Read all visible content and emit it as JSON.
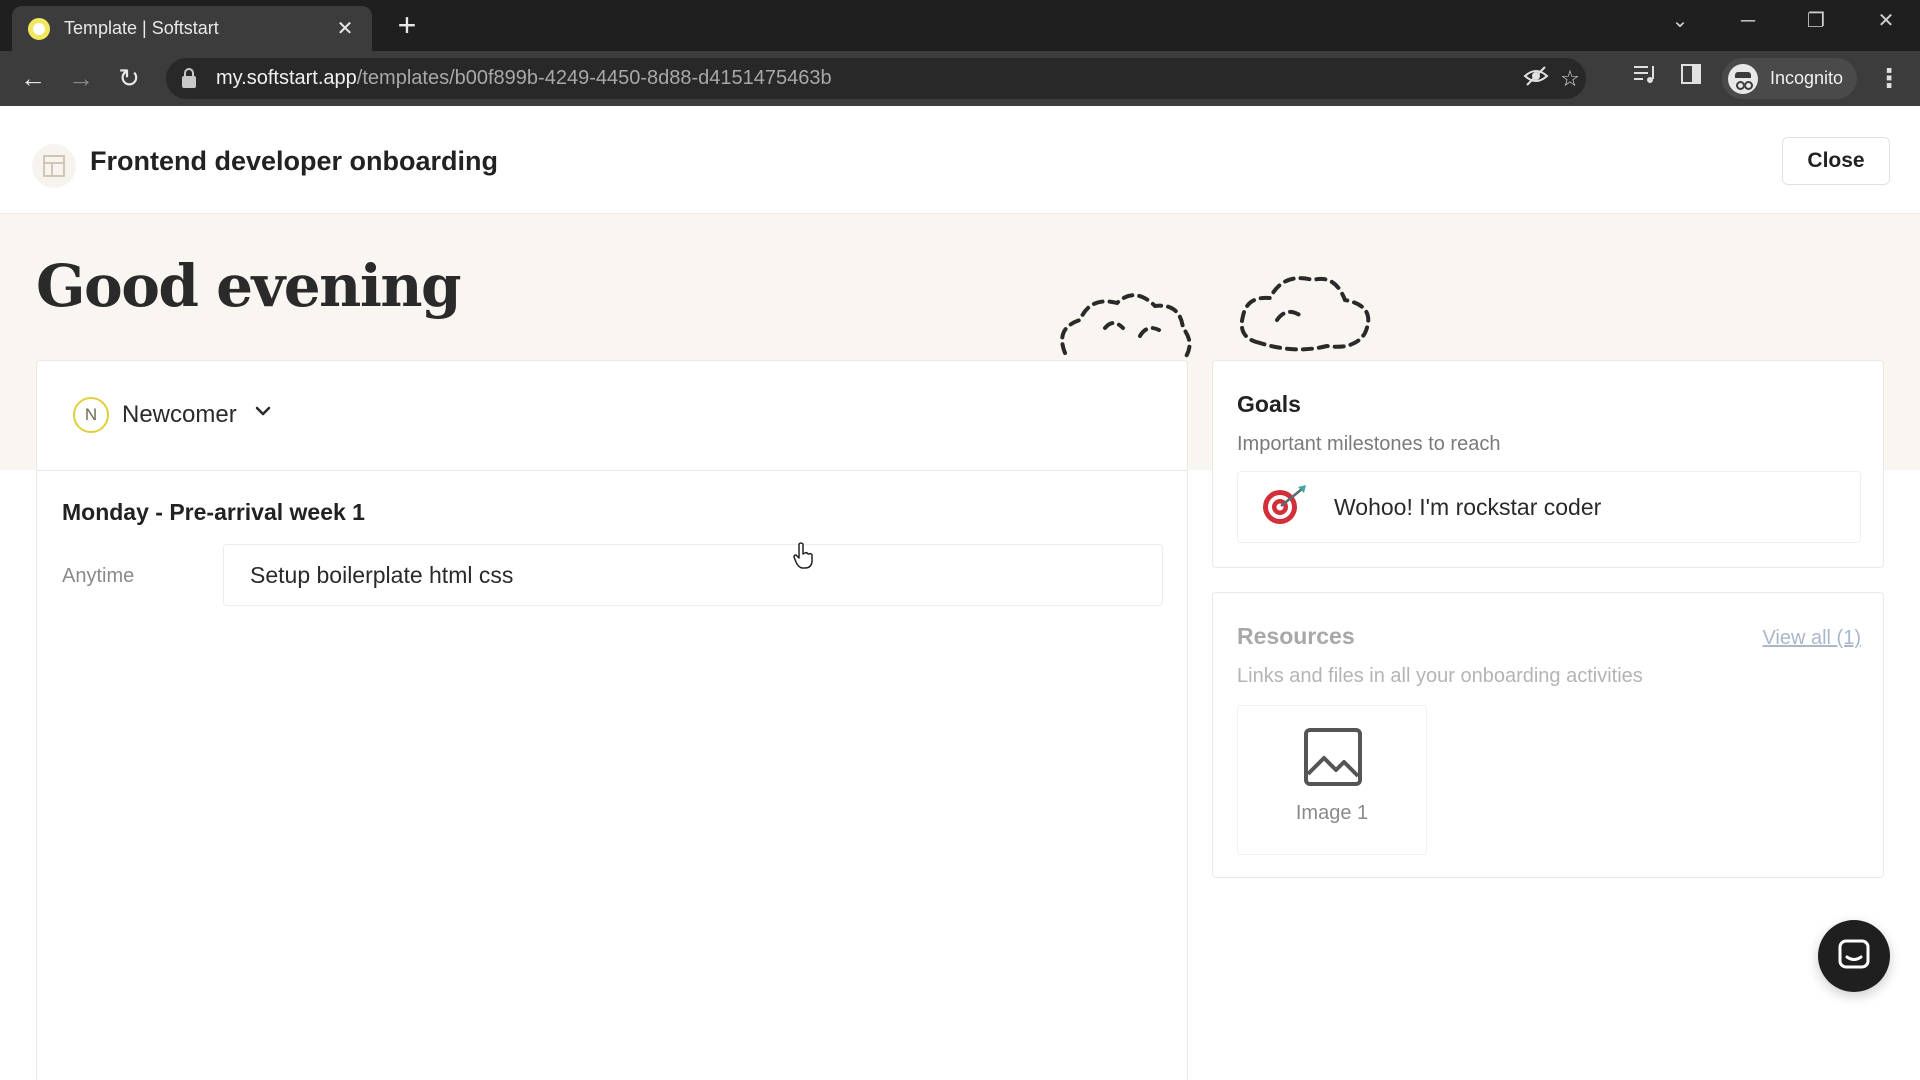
{
  "browser": {
    "tab_title": "Template | Softstart",
    "tab_close": "✕",
    "new_tab": "+",
    "url_host": "my.softstart.app",
    "url_path": "/templates/b00f899b-4249-4450-8d88-d4151475463b",
    "profile_label": "Incognito",
    "accent_favicon": "#f2e860"
  },
  "header": {
    "title": "Frontend developer onboarding",
    "close_label": "Close"
  },
  "hero": {
    "greeting": "Good evening"
  },
  "plan": {
    "role_initial": "N",
    "role_name": "Newcomer",
    "week_title": "Monday - Pre-arrival week 1",
    "tasks": [
      {
        "when": "Anytime",
        "title": "Setup boilerplate html css"
      }
    ]
  },
  "goals": {
    "title": "Goals",
    "subtitle": "Important milestones to reach",
    "items": [
      {
        "icon": "target-icon",
        "text": "Wohoo! I'm rockstar coder"
      }
    ]
  },
  "resources": {
    "title": "Resources",
    "subtitle": "Links and files in all your onboarding activities",
    "view_all": "View all (1)",
    "items": [
      {
        "icon": "image-icon",
        "label": "Image 1"
      }
    ]
  },
  "colors": {
    "hero_bg": "#f9f6f2",
    "role_badge": "#e0cf3c",
    "target_red": "#d32f3a",
    "link_muted": "#a9b7c9"
  }
}
